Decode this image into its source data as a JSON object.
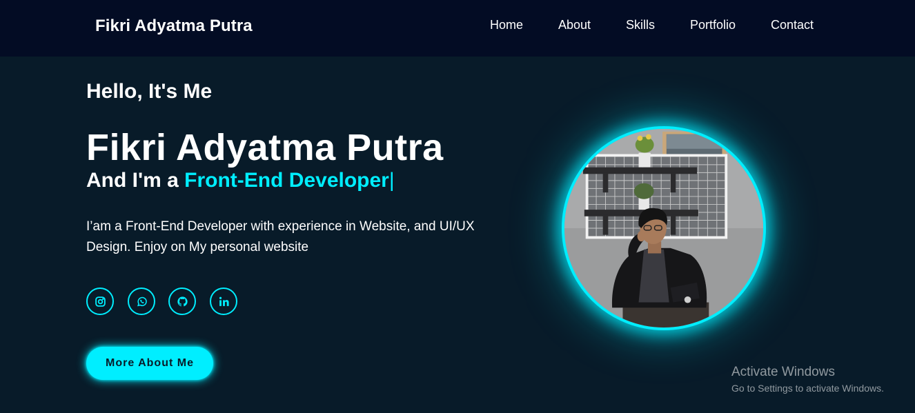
{
  "header": {
    "logo": "Fikri Adyatma Putra",
    "nav": [
      {
        "label": "Home"
      },
      {
        "label": "About"
      },
      {
        "label": "Skills"
      },
      {
        "label": "Portfolio"
      },
      {
        "label": "Contact"
      }
    ]
  },
  "hero": {
    "greeting": "Hello, It's Me",
    "name": "Fikri Adyatma Putra",
    "role_prefix": "And I'm a ",
    "role": "Front-End Developer",
    "caret": "|",
    "description": "I’am a Front-End Developer with experience in Website, and UI/UX Design. Enjoy on My personal website",
    "socials": [
      {
        "icon": "instagram-icon"
      },
      {
        "icon": "whatsapp-icon"
      },
      {
        "icon": "github-icon"
      },
      {
        "icon": "linkedin-icon"
      }
    ],
    "cta_label": "More About Me"
  },
  "watermark": {
    "title": "Activate Windows",
    "subtitle": "Go to Settings to activate Windows."
  },
  "colors": {
    "background": "#081b29",
    "header": "#030c24",
    "accent": "#00eeff",
    "text": "#ffffff"
  }
}
